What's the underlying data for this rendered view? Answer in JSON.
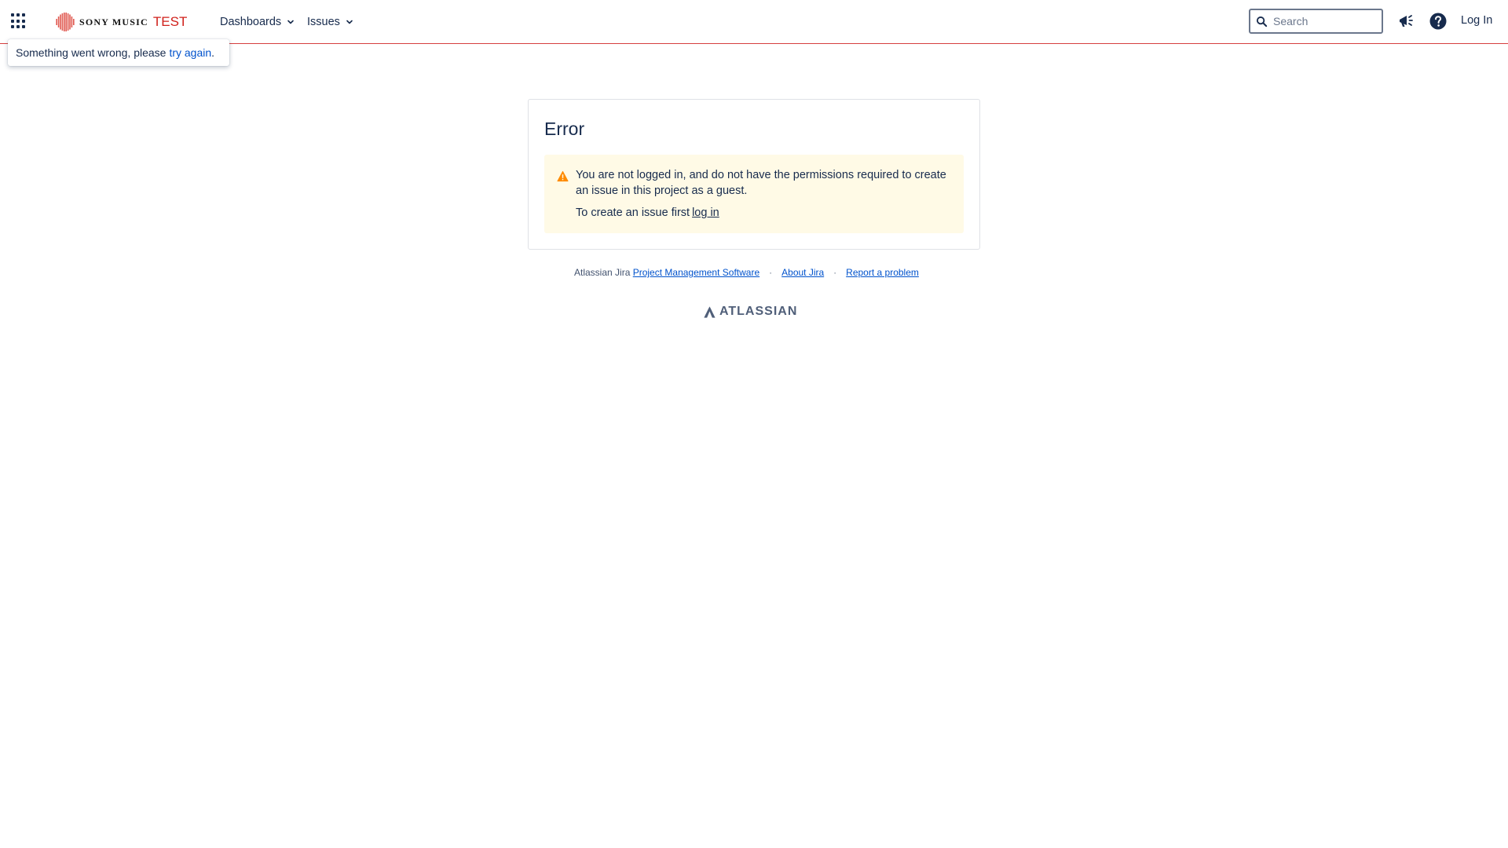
{
  "header": {
    "brand_name": "SONY MUSIC",
    "brand_suffix": "TEST",
    "nav": {
      "dashboards": "Dashboards",
      "issues": "Issues"
    },
    "search_placeholder": "Search",
    "login_label": "Log In",
    "accent_color": "#d63f3f"
  },
  "flag": {
    "message": "Something went wrong, please",
    "link_text": "try again"
  },
  "error_panel": {
    "title": "Error",
    "warning_text": "You are not logged in, and do not have the permissions required to create an issue in this project as a guest.",
    "login_prompt": "To create an issue first",
    "login_link": "log in",
    "warning_bg": "#fffae6",
    "warning_icon_color": "#ff8b00"
  },
  "footer": {
    "prefix": "Atlassian Jira",
    "links": {
      "pm_software": "Project Management Software",
      "about": "About Jira",
      "report": "Report a problem"
    },
    "separator": "·",
    "brand": "ATLASSIAN"
  }
}
